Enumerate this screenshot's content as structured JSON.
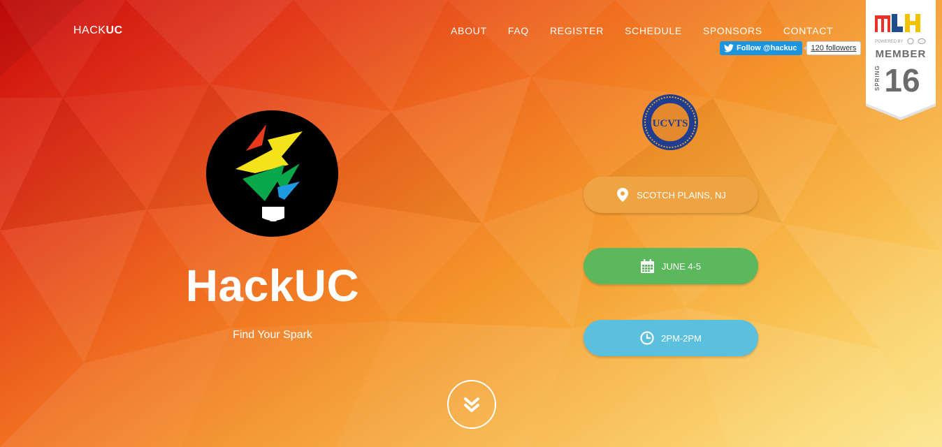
{
  "brand": {
    "prefix": "HACK",
    "suffix": "UC"
  },
  "nav": {
    "items": [
      {
        "label": "ABOUT"
      },
      {
        "label": "FAQ"
      },
      {
        "label": "REGISTER"
      },
      {
        "label": "SCHEDULE"
      },
      {
        "label": "SPONSORS"
      },
      {
        "label": "CONTACT"
      }
    ]
  },
  "twitter": {
    "follow_label": "Follow @hackuc",
    "followers": "120 followers",
    "color": "#1b95e0"
  },
  "mlh_badge": {
    "logo": "MLH",
    "powered_by": "POWERED BY",
    "member": "MEMBER",
    "season": "SPRING",
    "year": "16"
  },
  "hero": {
    "title": "HackUC",
    "tagline": "Find Your Spark"
  },
  "seal": {
    "text": "UCVTS"
  },
  "info": {
    "location": "SCOTCH PLAINS, NJ",
    "date": "JUNE 4-5",
    "time": "2PM-2PM",
    "colors": {
      "location": "#efa444",
      "date": "#5cb85c",
      "time": "#5bc0de"
    }
  },
  "icons": {
    "location": "map-pin-icon",
    "date": "calendar-icon",
    "time": "clock-icon",
    "scroll": "double-chevron-down-icon",
    "twitter": "twitter-bird-icon"
  }
}
